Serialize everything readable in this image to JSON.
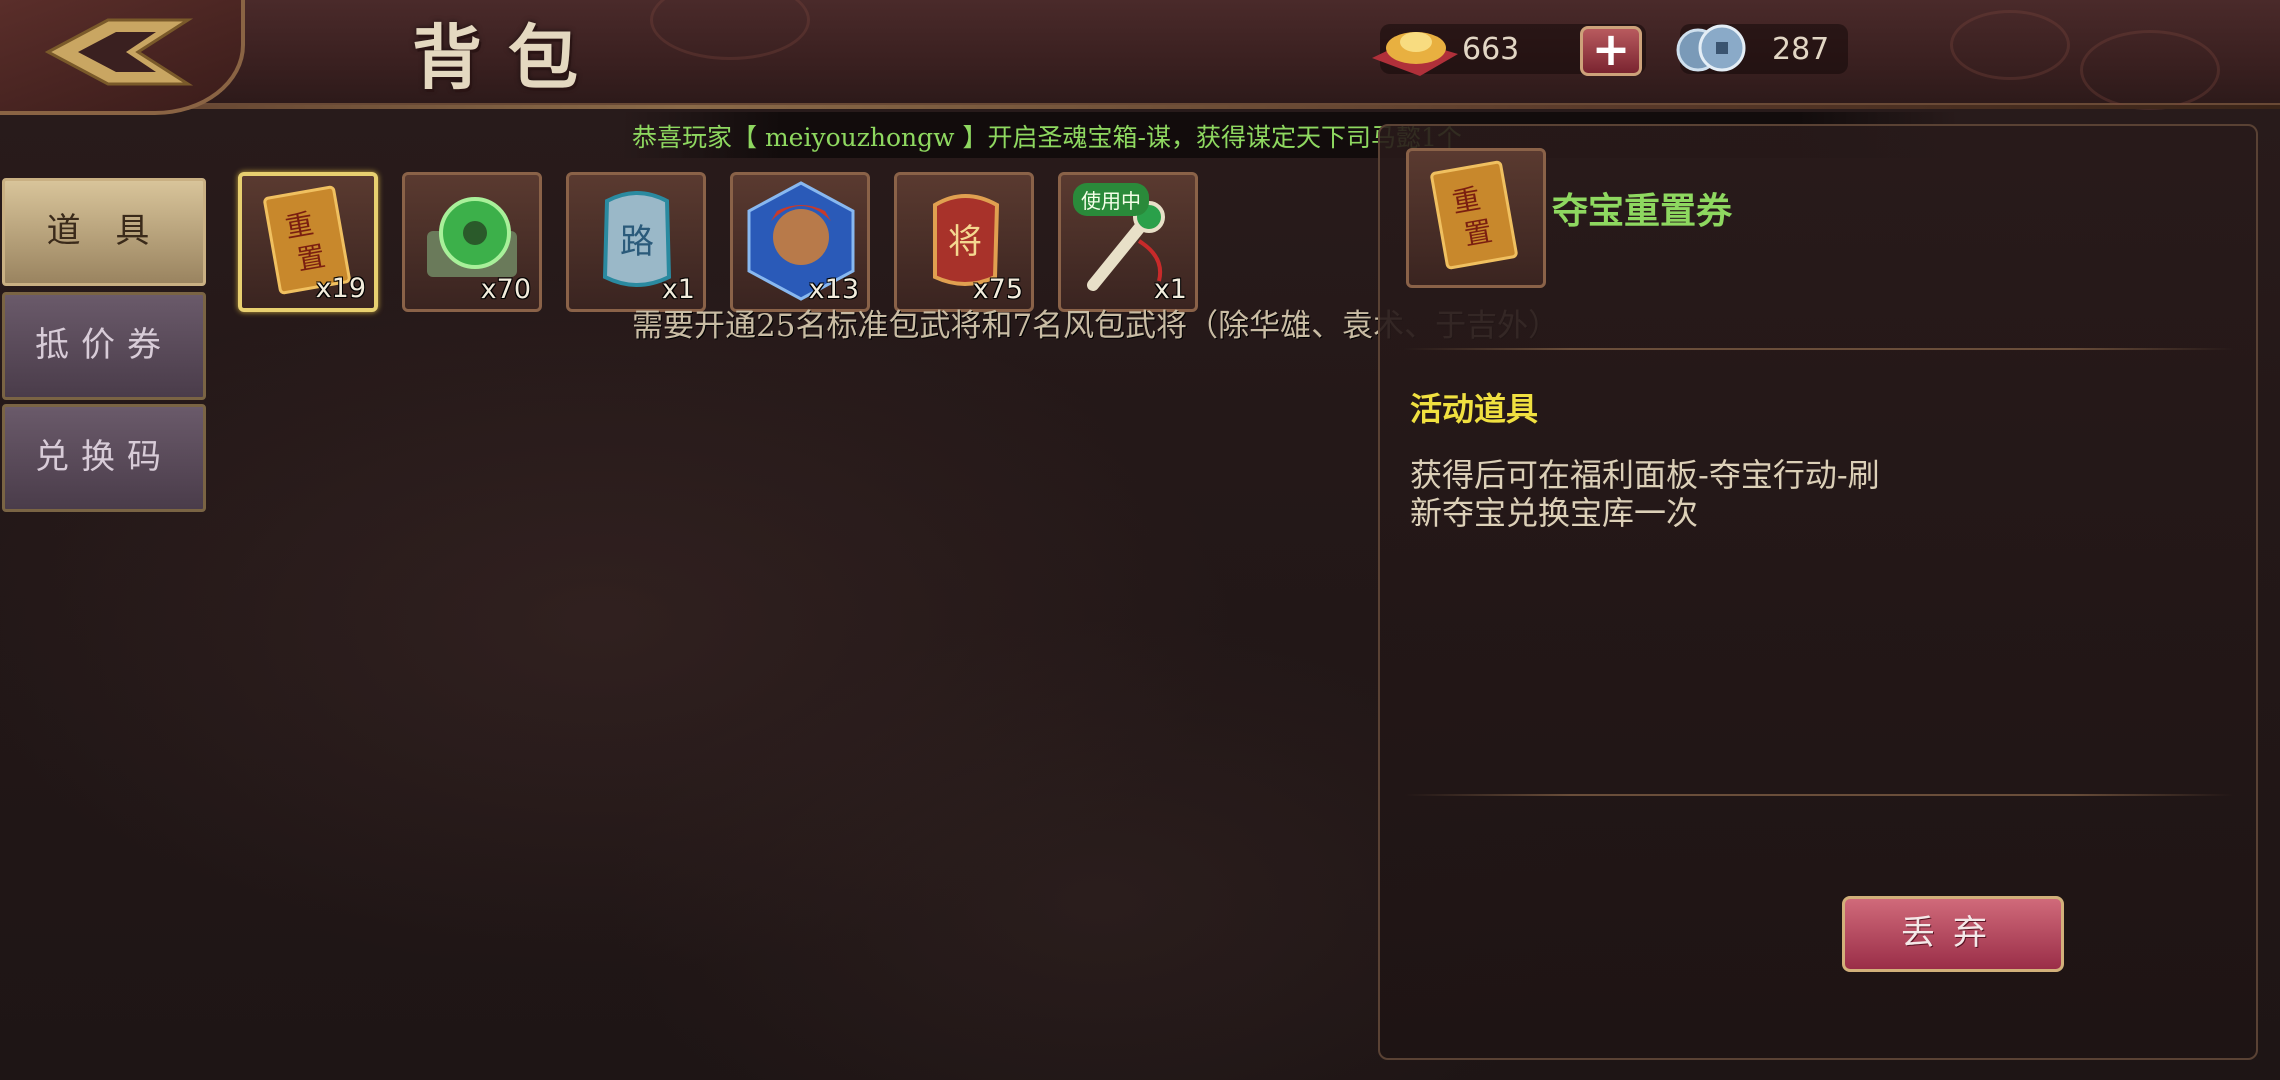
{
  "header": {
    "title": "背包",
    "gold_value": "663",
    "silver_value": "287"
  },
  "notice": {
    "text": "恭喜玩家【 meiyouzhongw 】开启圣魂宝箱-谋，获得谋定天下司马懿1个"
  },
  "tabs": [
    {
      "label": "道 具",
      "active": true
    },
    {
      "label": "抵价券",
      "active": false
    },
    {
      "label": "兑换码",
      "active": false
    }
  ],
  "inventory": [
    {
      "icon": "reset-book-icon",
      "qty": "x19",
      "selected": true
    },
    {
      "icon": "jade-disc-icon",
      "qty": "x70",
      "selected": false
    },
    {
      "icon": "token-plaque-icon",
      "qty": "x1",
      "selected": false
    },
    {
      "icon": "general-portrait-icon",
      "qty": "x13",
      "selected": false
    },
    {
      "icon": "general-card-icon",
      "qty": "x75",
      "selected": false
    },
    {
      "icon": "scroll-key-icon",
      "qty": "x1",
      "selected": false,
      "badge": "使用中"
    }
  ],
  "requirement_text": "需要开通25名标准包武将和7名风包武将（除华雄、袁术、于吉外）",
  "detail": {
    "icon_label": "重置",
    "name": "夺宝重置券",
    "category": "活动道具",
    "description": "获得后可在福利面板-夺宝行动-刷新夺宝兑换宝库一次",
    "discard_label": "丢弃"
  },
  "colors": {
    "accent_green": "#8ed860",
    "category_yellow": "#f0e040",
    "discard_red": "#9a2e48"
  }
}
